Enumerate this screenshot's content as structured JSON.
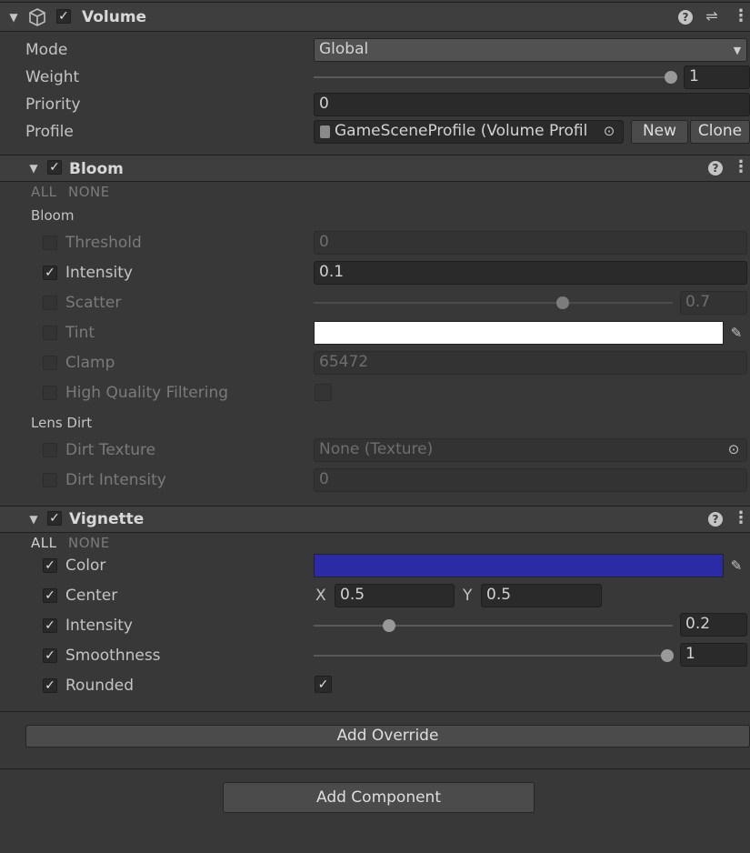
{
  "volume": {
    "title": "Volume",
    "mode_label": "Mode",
    "mode_value": "Global",
    "weight_label": "Weight",
    "weight_value": "1",
    "weight_fraction": 1.0,
    "priority_label": "Priority",
    "priority_value": "0",
    "profile_label": "Profile",
    "profile_value": "GameSceneProfile (Volume Profil",
    "new_label": "New",
    "clone_label": "Clone"
  },
  "bloom": {
    "title": "Bloom",
    "all_label": "ALL",
    "none_label": "NONE",
    "section_bloom": "Bloom",
    "threshold_label": "Threshold",
    "threshold_value": "0",
    "intensity_label": "Intensity",
    "intensity_value": "0.1",
    "scatter_label": "Scatter",
    "scatter_value": "0.7",
    "scatter_fraction": 0.7,
    "tint_label": "Tint",
    "tint_color": "#ffffff",
    "clamp_label": "Clamp",
    "clamp_value": "65472",
    "hq_label": "High Quality Filtering",
    "section_lens": "Lens Dirt",
    "dirt_texture_label": "Dirt Texture",
    "dirt_texture_value": "None (Texture)",
    "dirt_intensity_label": "Dirt Intensity",
    "dirt_intensity_value": "0"
  },
  "vignette": {
    "title": "Vignette",
    "all_label": "ALL",
    "none_label": "NONE",
    "color_label": "Color",
    "color_value": "#2b2ba6",
    "center_label": "Center",
    "center_x_label": "X",
    "center_x_value": "0.5",
    "center_y_label": "Y",
    "center_y_value": "0.5",
    "intensity_label": "Intensity",
    "intensity_value": "0.2",
    "intensity_fraction": 0.2,
    "smoothness_label": "Smoothness",
    "smoothness_value": "1",
    "smoothness_fraction": 1.0,
    "rounded_label": "Rounded"
  },
  "add_override_label": "Add Override",
  "add_component_label": "Add Component",
  "icons": {
    "check": "✓",
    "fold": "▼",
    "help": "?",
    "more": "⋮",
    "presets": "⇌",
    "dropdown": "▼",
    "eyedropper": "✎",
    "target": "⊙"
  }
}
